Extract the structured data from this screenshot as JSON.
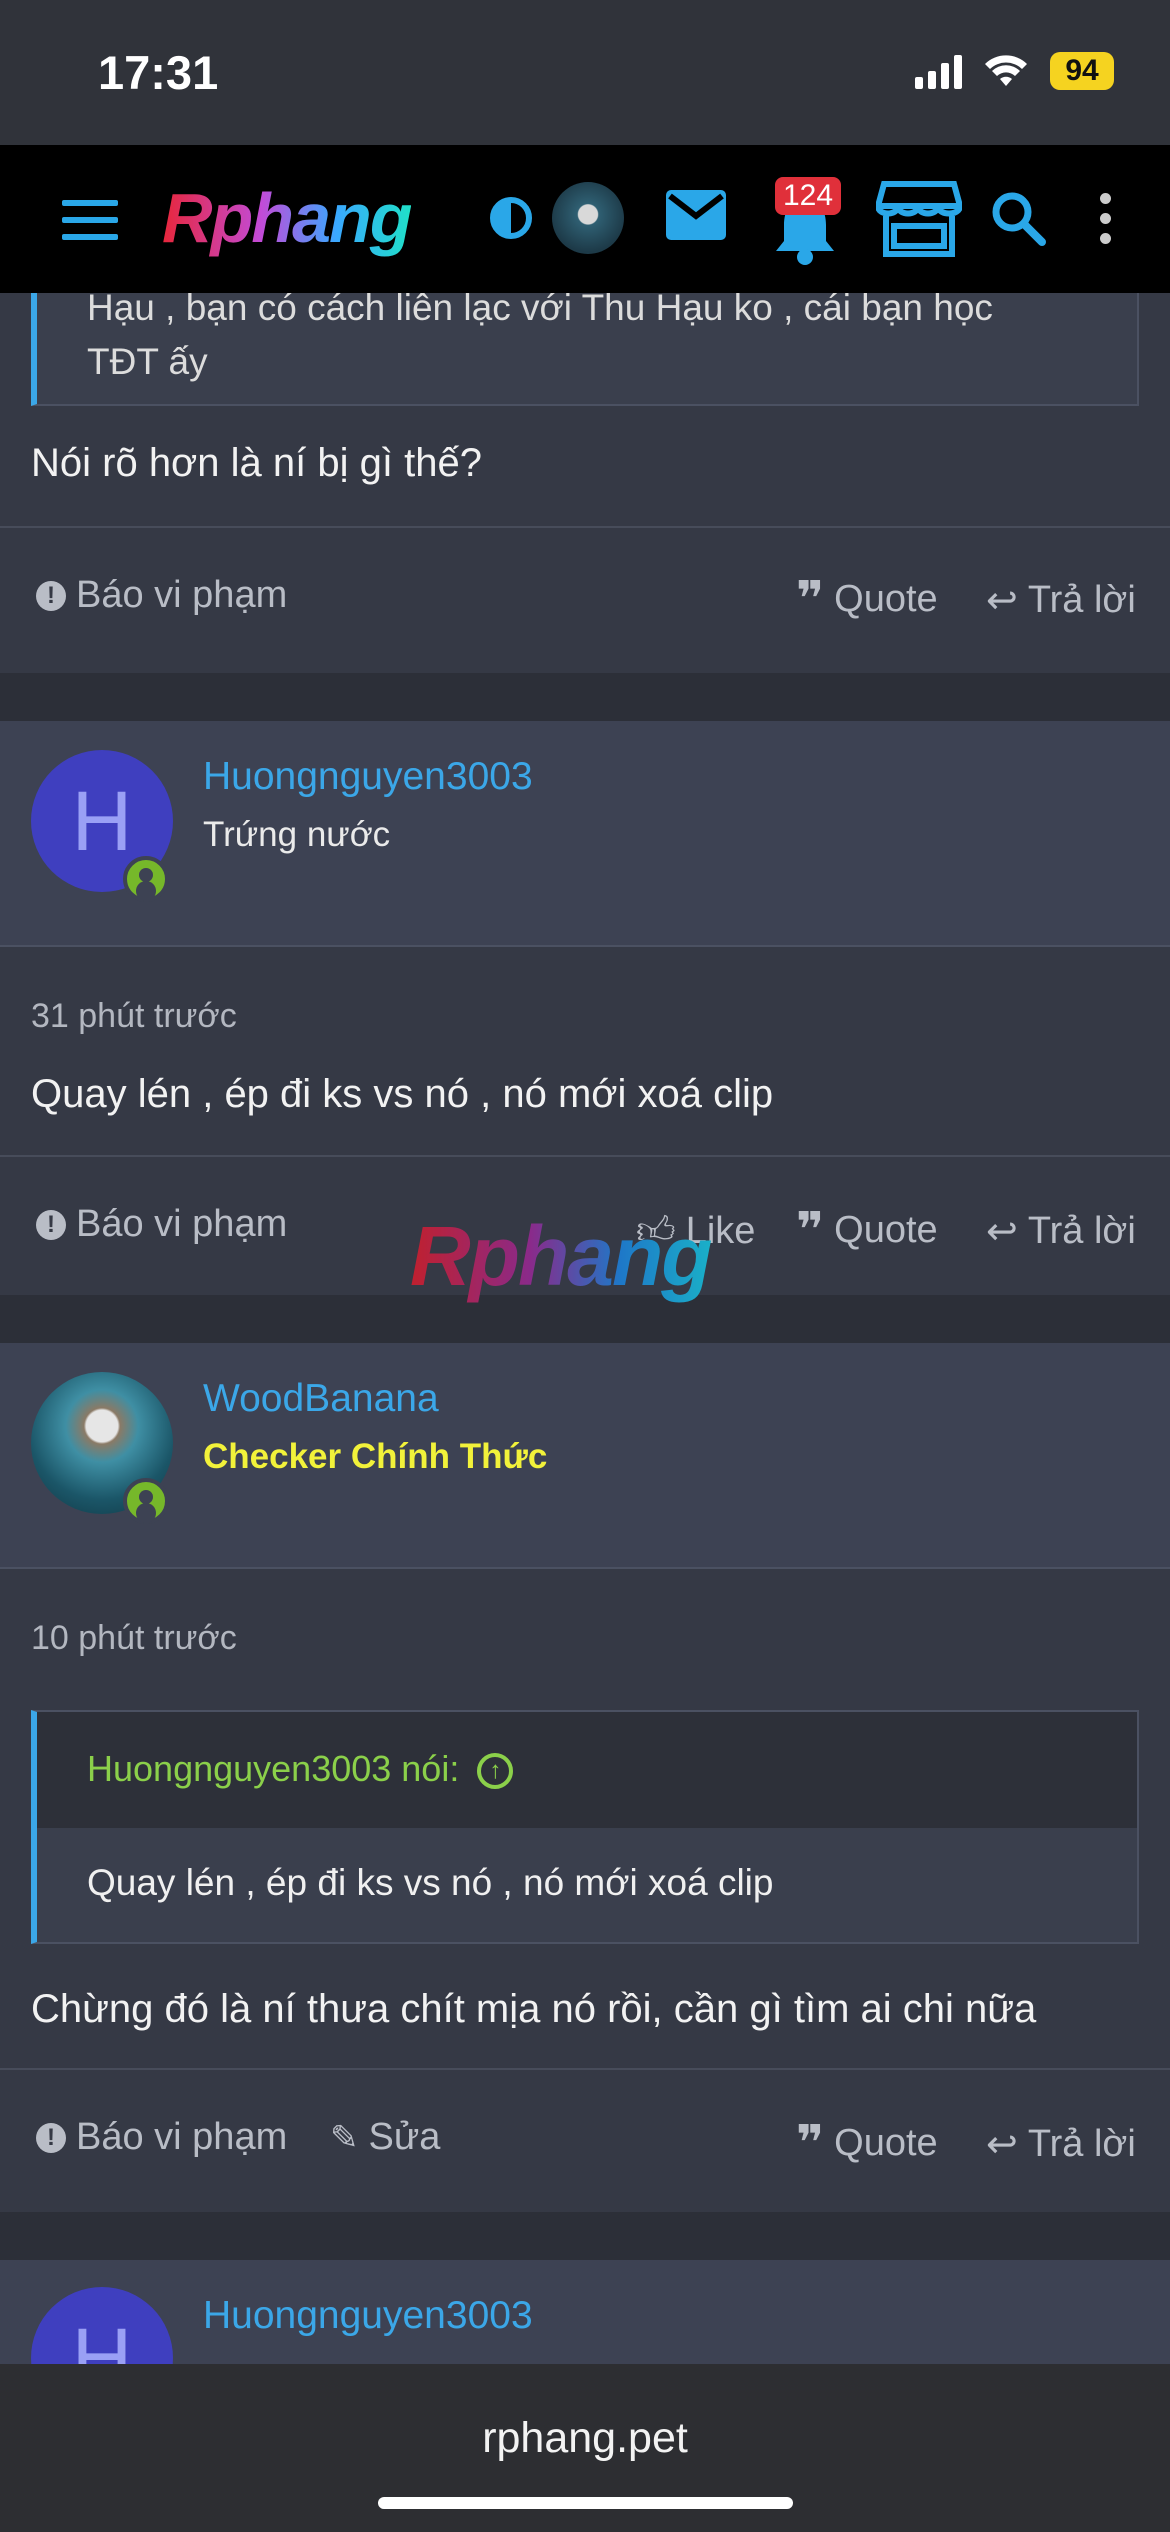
{
  "status": {
    "time": "17:31",
    "battery": "94"
  },
  "nav": {
    "logo": "Rphang",
    "notifications": "124"
  },
  "top_post": {
    "quote_partial_line1": "Hạu , bạn có cách liên lạc với Thu Hạu ko , cái bạn học",
    "quote_partial_line2": "TĐT ấy",
    "message": "Nói rõ hơn là ní bị gì thế?",
    "actions": {
      "report": "Báo vi phạm",
      "quote": "Quote",
      "reply": "Trả lời"
    }
  },
  "posts": [
    {
      "avatar_letter": "H",
      "username": "Huongnguyen3003",
      "user_title": "Trứng nước",
      "time": "31 phút trước",
      "message": "Quay lén , ép đi ks vs nó , nó mới xoá clip",
      "actions": {
        "report": "Báo vi phạm",
        "like": "Like",
        "quote": "Quote",
        "reply": "Trả lời"
      }
    },
    {
      "username": "WoodBanana",
      "user_title": "Checker Chính Thức",
      "time": "10 phút trước",
      "quote_author": "Huongnguyen3003 nói:",
      "quote_text": "Quay lén , ép đi ks vs nó , nó mới xoá clip",
      "message": "Chừng đó là ní thưa chít mịa nó rồi, cần gì tìm ai chi nữa",
      "actions": {
        "report": "Báo vi phạm",
        "edit": "Sửa",
        "quote": "Quote",
        "reply": "Trả lời"
      }
    },
    {
      "avatar_letter": "H",
      "username": "Huongnguyen3003"
    }
  ],
  "watermark": "Rphang",
  "browser": {
    "url": "rphang.pet"
  },
  "colors": {
    "accent": "#3ba7e8",
    "online": "#76b82a",
    "checker": "#f2f23a",
    "quote_author": "#8bd04a"
  }
}
